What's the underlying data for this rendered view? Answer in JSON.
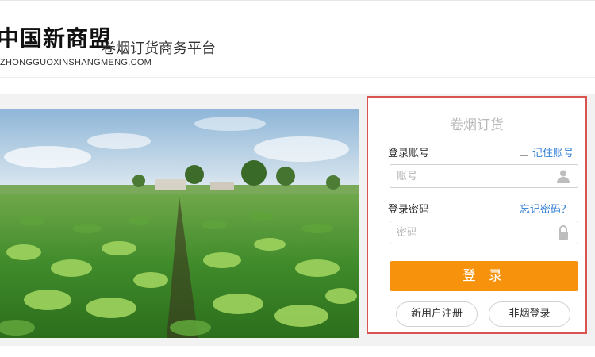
{
  "header": {
    "logo_cn": "中国新商盟",
    "logo_en": "ZHONGGUOXINSHANGMENG.COM",
    "platform_name": "卷烟订货商务平台"
  },
  "login": {
    "title": "卷烟订货",
    "account_label": "登录账号",
    "remember_label": "记住账号",
    "account_placeholder": "账号",
    "password_label": "登录密码",
    "forgot_label": "忘记密码？",
    "password_placeholder": "密码",
    "submit_label": "登录",
    "register_label": "新用户注册",
    "nontobacco_label": "非烟登录"
  },
  "colors": {
    "accent": "#f7920c",
    "link": "#2f7fd6",
    "panel_border": "#d9534f"
  }
}
